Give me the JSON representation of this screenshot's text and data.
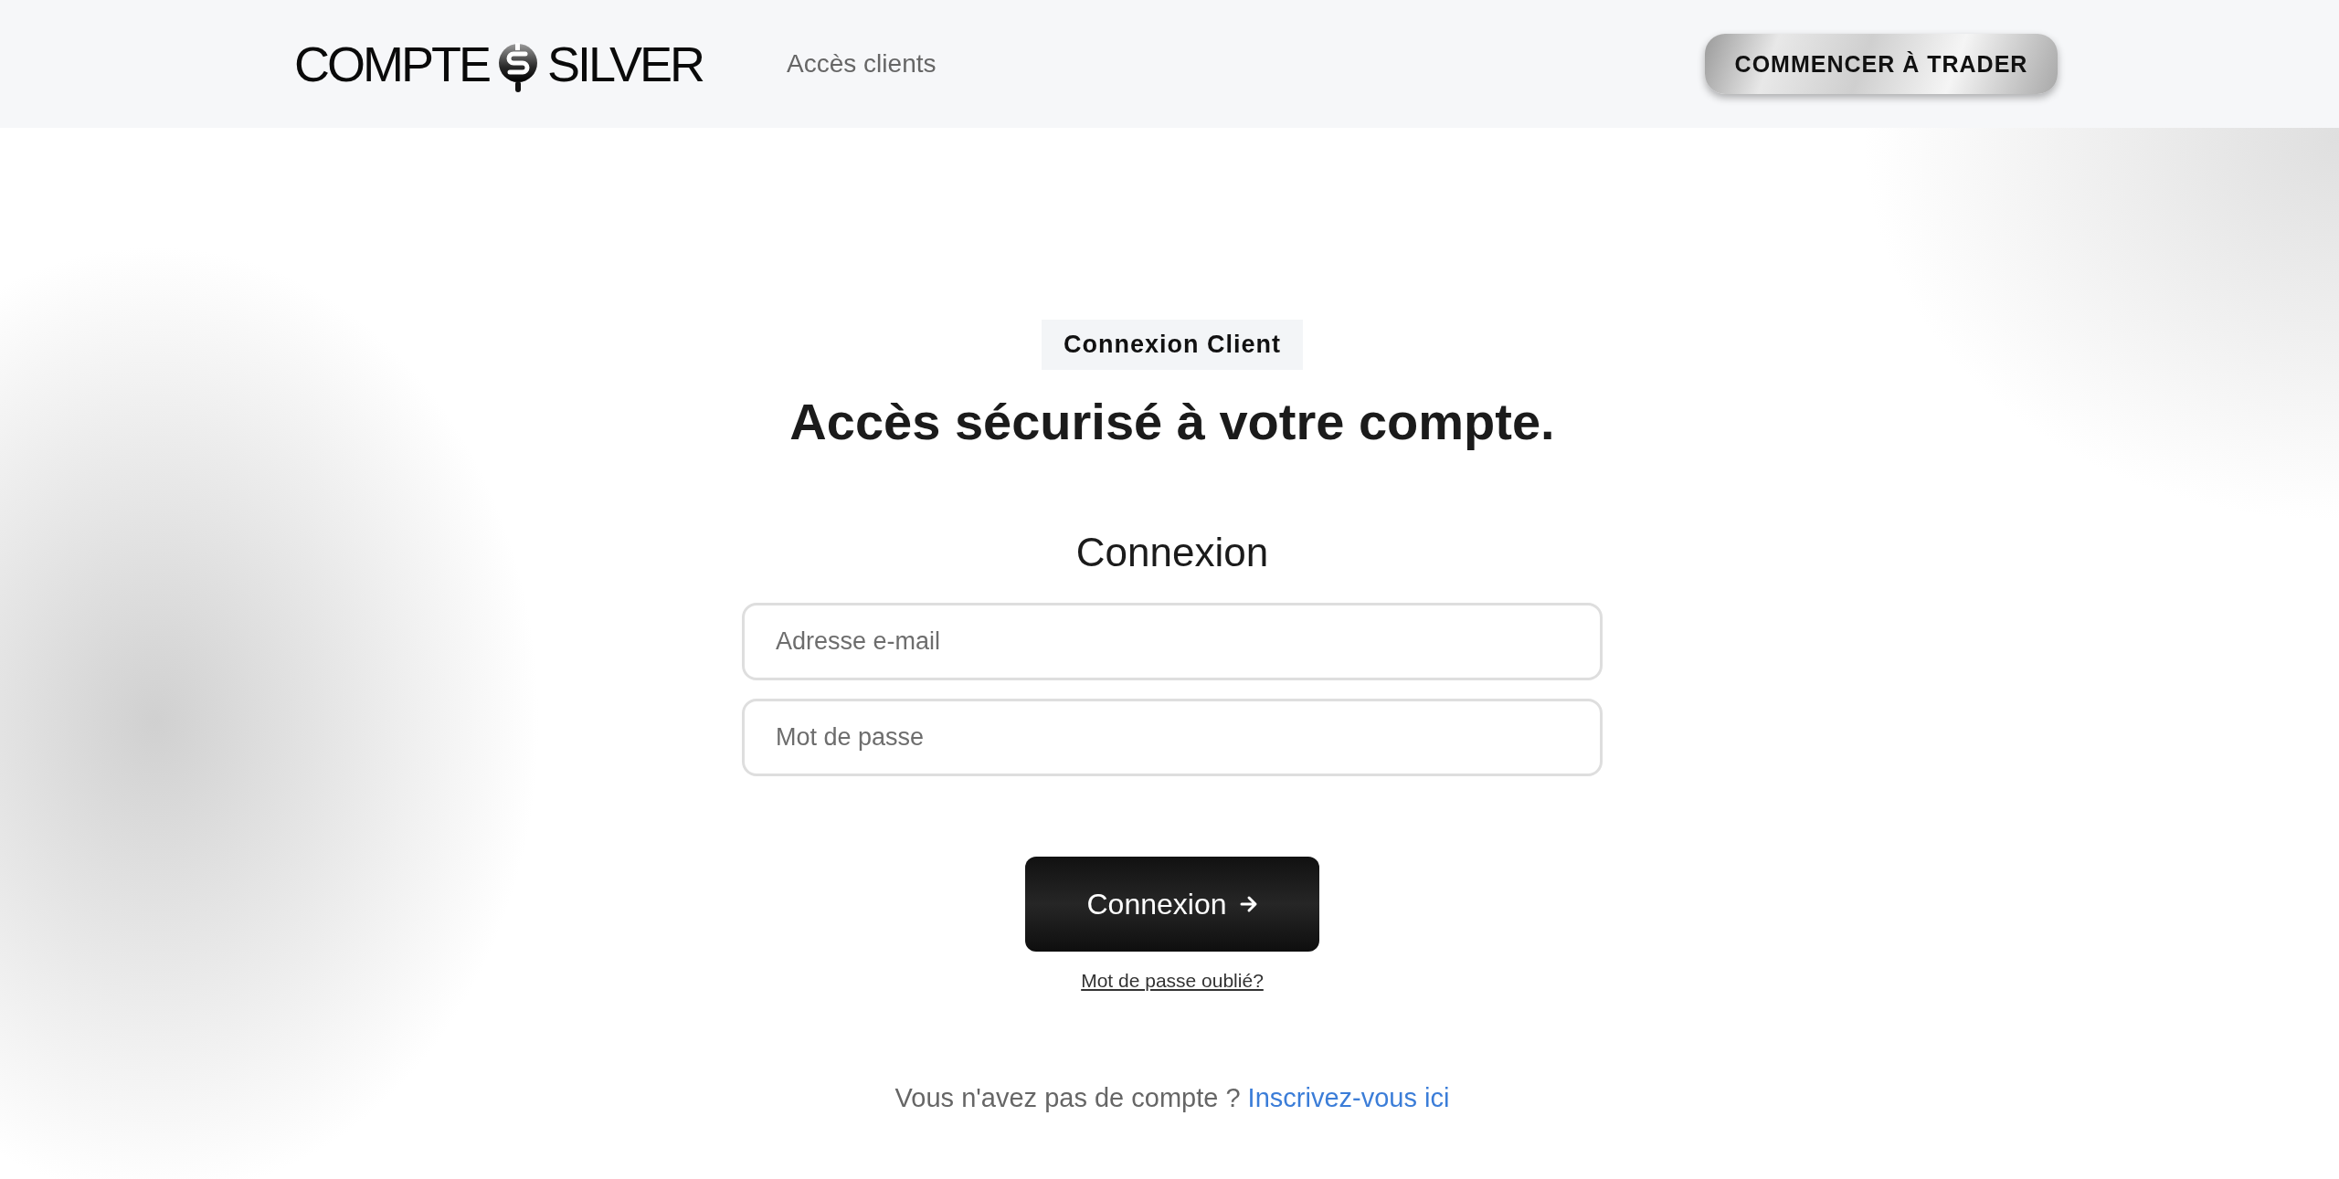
{
  "header": {
    "logo": {
      "left": "COMPTE",
      "right": "SILVER"
    },
    "nav_link": "Accès clients",
    "cta_button": "COMMENCER À TRADER"
  },
  "badge": "Connexion Client",
  "heading": "Accès sécurisé à votre compte.",
  "form": {
    "title": "Connexion",
    "fields": [
      {
        "placeholder": "Adresse e-mail"
      },
      {
        "placeholder": "Mot de passe"
      }
    ],
    "submit": "Connexion",
    "forgot_link": "Mot de passe oublié?"
  },
  "signup": {
    "prompt": "Vous n'avez pas de compte ?",
    "link": "Inscrivez-vous ici"
  }
}
